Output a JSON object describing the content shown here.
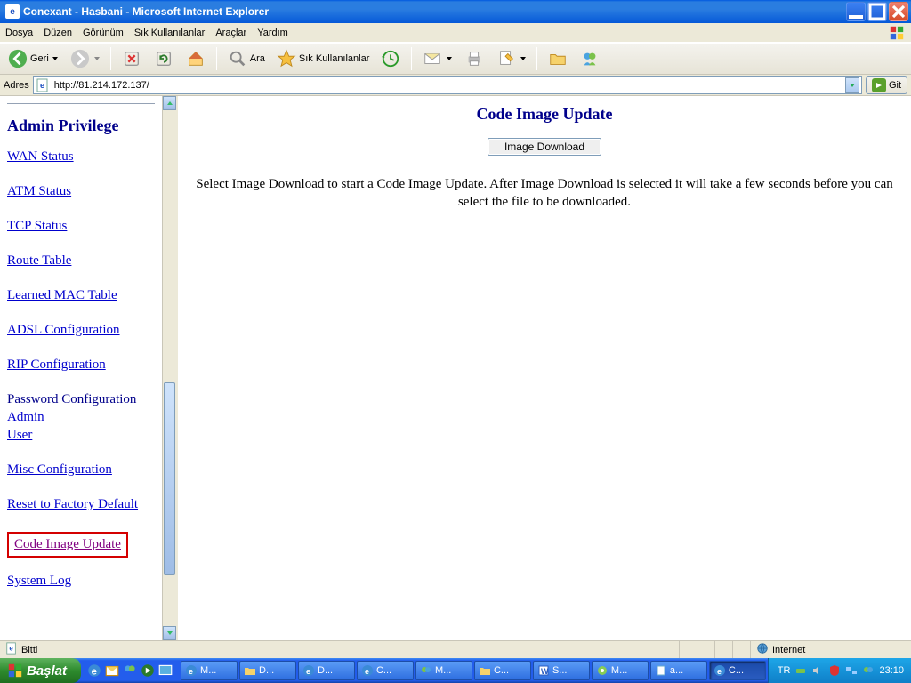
{
  "window": {
    "title": "Conexant - Hasbani - Microsoft Internet Explorer"
  },
  "menu": {
    "items": [
      "Dosya",
      "Düzen",
      "Görünüm",
      "Sık Kullanılanlar",
      "Araçlar",
      "Yardım"
    ]
  },
  "toolbar": {
    "back_label": "Geri",
    "search_label": "Ara",
    "favorites_label": "Sık Kullanılanlar"
  },
  "addressbar": {
    "label": "Adres",
    "url": "http://81.214.172.137/",
    "go_label": "Git"
  },
  "sidebar": {
    "heading": "Admin Privilege",
    "links": {
      "wan": "WAN Status",
      "atm": "ATM Status",
      "tcp": "TCP Status",
      "route": "Route Table",
      "mac": "Learned MAC Table",
      "adsl": "ADSL Configuration",
      "rip": "RIP Configuration",
      "pwd_group": "Password Configuration",
      "admin": "Admin",
      "user": "User",
      "misc": "Misc Configuration",
      "reset": "Reset to Factory Default",
      "code": "Code Image Update",
      "syslog": "System Log"
    }
  },
  "main": {
    "title": "Code Image Update",
    "download_button": "Image Download",
    "description": "Select Image Download to start a Code Image Update. After Image Download is selected it will take a few seconds before you can select the file to be downloaded."
  },
  "statusbar": {
    "left": "Bitti",
    "zone": "Internet"
  },
  "taskbar": {
    "start": "Başlat",
    "tasks": [
      {
        "label": "M...",
        "icon": "ie"
      },
      {
        "label": "D...",
        "icon": "folder"
      },
      {
        "label": "D...",
        "icon": "ie"
      },
      {
        "label": "C...",
        "icon": "ie"
      },
      {
        "label": "M...",
        "icon": "msn"
      },
      {
        "label": "C...",
        "icon": "folder"
      },
      {
        "label": "S...",
        "icon": "word"
      },
      {
        "label": "M...",
        "icon": "limewire"
      },
      {
        "label": "a...",
        "icon": "notepad"
      },
      {
        "label": "C...",
        "icon": "ie",
        "active": true
      }
    ],
    "tray": {
      "lang": "TR",
      "time": "23:10"
    }
  }
}
